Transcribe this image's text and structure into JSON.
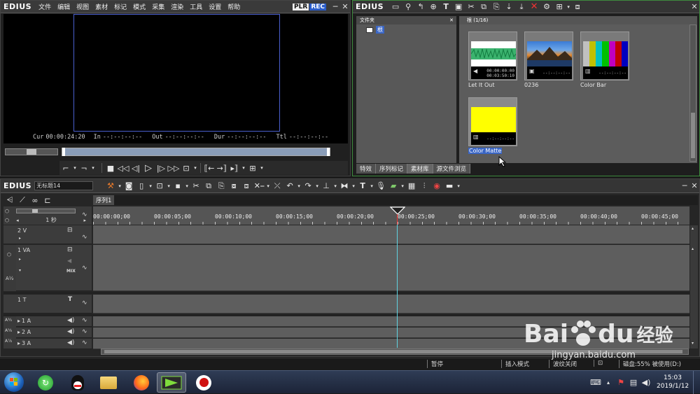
{
  "player": {
    "logo": "EDIUS",
    "menu": [
      "文件",
      "编辑",
      "视图",
      "素材",
      "标记",
      "模式",
      "采集",
      "渲染",
      "工具",
      "设置",
      "帮助"
    ],
    "plr": "PLR",
    "rec": "REC",
    "timecodes": {
      "cur_label": "Cur",
      "cur_value": "00:00:24:20",
      "in_label": "In",
      "in_value": "--:--:--:--",
      "out_label": "Out",
      "out_value": "--:--:--:--",
      "dur_label": "Dur",
      "dur_value": "--:--:--:--",
      "ttl_label": "Ttl",
      "ttl_value": "--:--:--:--"
    }
  },
  "bin": {
    "logo": "EDIUS",
    "folder_panel_title": "文件夹",
    "root_folder": "根",
    "clip_panel_title": "根 (1/16)",
    "clips": [
      {
        "name": "Let It Out",
        "tc1": "00:00:00:00",
        "tc2": "00:03:50:10"
      },
      {
        "name": "0236",
        "tc1": "--:--:--:--"
      },
      {
        "name": "Color Bar",
        "tc1": "--:--:--:--"
      },
      {
        "name": "Color Matte",
        "tc1": "--:--:--:--"
      }
    ],
    "tabs": [
      "特效",
      "序列标记",
      "素材库",
      "源文件浏览"
    ]
  },
  "timeline": {
    "logo": "EDIUS",
    "project_name": "无标题14",
    "sequence_tab": "序列1",
    "zoom_label": "1 秒",
    "ruler": [
      "00:00:00;00",
      "00:00:05;00",
      "00:00:10;00",
      "00:00:15;00",
      "00:00:20;00",
      "00:00:25;00",
      "00:00:30;00",
      "00:00:35;00",
      "00:00:40;00",
      "00:00:45;00"
    ],
    "tracks": [
      {
        "label": "2 V"
      },
      {
        "label": "1 VA",
        "mix": "MIX"
      },
      {
        "label": "1 T"
      },
      {
        "label": "1 A"
      },
      {
        "label": "2 A"
      },
      {
        "label": "3 A"
      }
    ]
  },
  "status": {
    "state": "暂停",
    "insert_mode": "插入模式",
    "ripple": "波纹关闭",
    "disk": "磁盘:55% 被使用(D:)"
  },
  "taskbar": {
    "time": "15:03",
    "date": "2019/1/12"
  },
  "watermark": {
    "brand": "Bai",
    "brand2": "du",
    "cn": "经验",
    "url": "jingyan.baidu.com"
  }
}
